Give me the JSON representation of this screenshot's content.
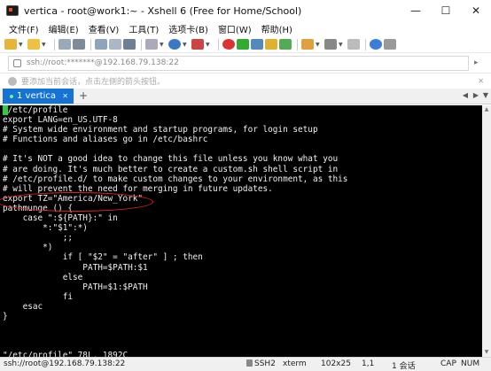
{
  "window": {
    "title": "vertica - root@work1:~ - Xshell 6 (Free for Home/School)",
    "minimize": "—",
    "maximize": "☐",
    "close": "✕"
  },
  "menu": [
    "文件(F)",
    "编辑(E)",
    "查看(V)",
    "工具(T)",
    "选项卡(B)",
    "窗口(W)",
    "帮助(H)"
  ],
  "address": {
    "value": "ssh://root:*******@192.168.79.138:22",
    "arrow": "▸"
  },
  "hint": {
    "text": "要添加当前会话，点击左侧的箭头按钮。",
    "close": "✕"
  },
  "tab": {
    "label": "1 vertica",
    "close": "✕",
    "add": "+"
  },
  "terminal": {
    "lines": [
      " /etc/profile",
      "export LANG=en_US.UTF-8",
      "# System wide environment and startup programs, for login setup",
      "# Functions and aliases go in /etc/bashrc",
      "",
      "# It's NOT a good idea to change this file unless you know what you",
      "# are doing. It's much better to create a custom.sh shell script in",
      "# /etc/profile.d/ to make custom changes to your environment, as this",
      "# will prevent the need for merging in future updates.",
      "export TZ=\"America/New_York\"",
      "pathmunge () {",
      "    case \":${PATH}:\" in",
      "        *:\"$1\":*)",
      "            ;;",
      "        *)",
      "            if [ \"$2\" = \"after\" ] ; then",
      "                PATH=$PATH:$1",
      "            else",
      "                PATH=$1:$PATH",
      "            fi",
      "    esac",
      "}",
      "",
      "",
      "",
      "\"/etc/profile\" 78L, 1892C"
    ]
  },
  "status": {
    "connection": "ssh://root@192.168.79.138:22",
    "protocol": "SSH2",
    "terminal": "xterm",
    "size": "102x25",
    "cursor_pos": "1,1",
    "sessions": "1 会话",
    "cap": "CAP",
    "num": "NUM"
  },
  "colors": {
    "tab_active": "#1573d6",
    "terminal_bg": "#000000",
    "terminal_fg": "#f0f0f0",
    "cursor": "#2ecc40",
    "annotation": "#e22222"
  }
}
